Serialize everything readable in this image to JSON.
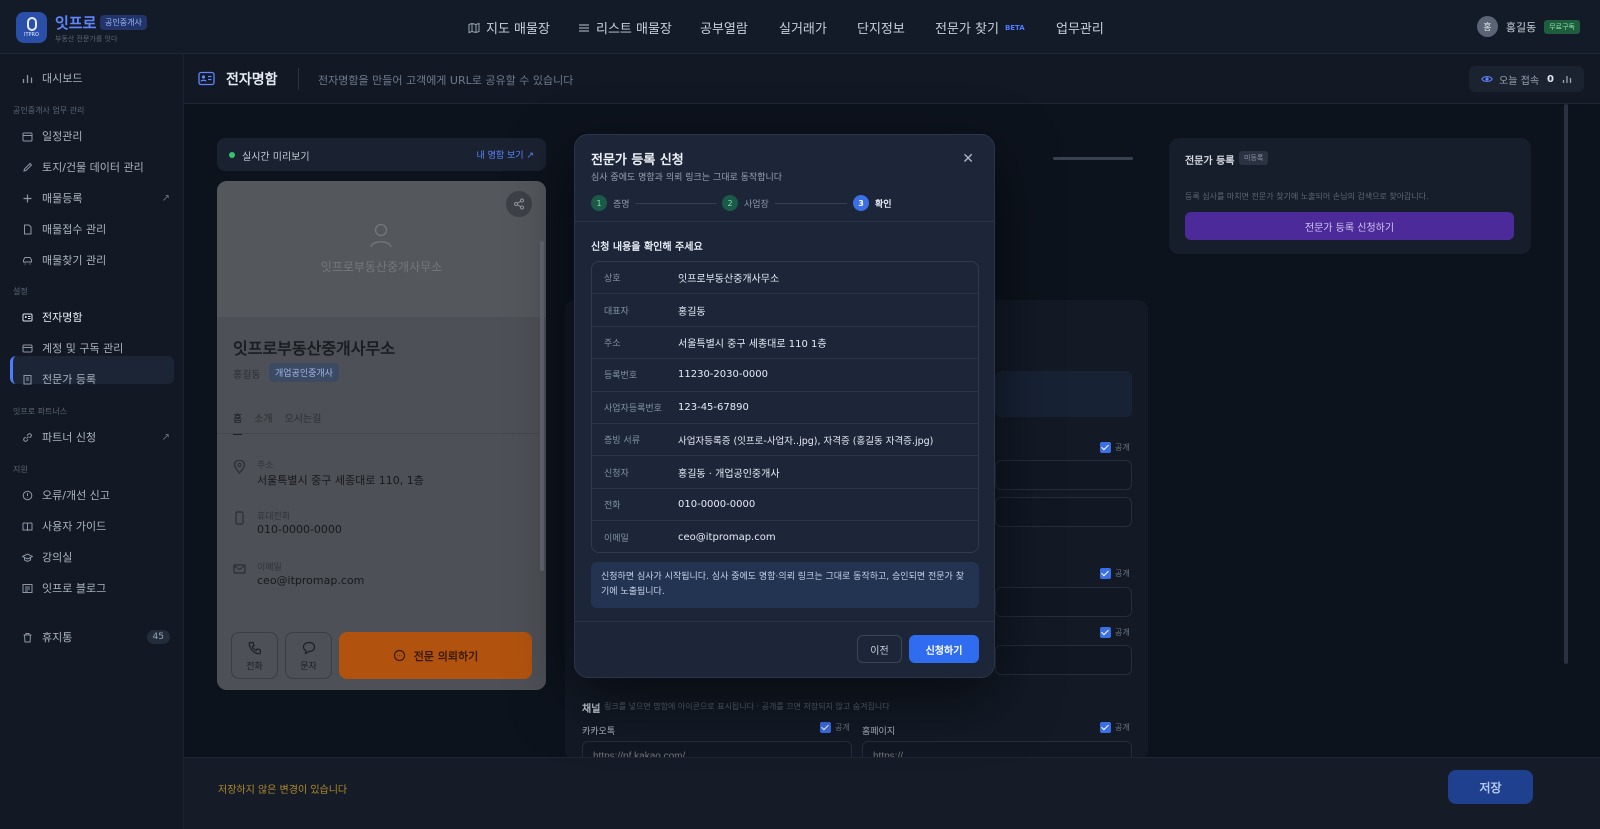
{
  "app": {
    "brand": "잇프로",
    "brand_badge": "공인중개사",
    "tagline": "부동산 전문가를 잇다",
    "logo_text": "ITPRO"
  },
  "nav": {
    "items": [
      "지도 매물장",
      "리스트 매물장",
      "공부열람",
      "실거래가",
      "단지정보",
      "전문가 찾기",
      "업무관리"
    ],
    "beta": "BETA"
  },
  "user": {
    "avatar": "홍",
    "name": "홍길동",
    "plan": "무료구독"
  },
  "sidebar": {
    "dashboard": "대시보드",
    "section1": "공인중개사 업무 관리",
    "items1": [
      "일정관리",
      "토지/건물 데이터 관리",
      "매물등록",
      "매물접수 관리",
      "매물찾기 관리"
    ],
    "section2": "설정",
    "items2": [
      "전자명함",
      "계정 및 구독 관리",
      "전문가 등록"
    ],
    "section3": "잇프로 파트너스",
    "partner": "파트너 신청",
    "section4": "지원",
    "items4": [
      "오류/개선 신고",
      "사용자 가이드",
      "강의실",
      "잇프로 블로그"
    ],
    "trash": "휴지통",
    "trash_count": "45"
  },
  "page": {
    "title": "전자명함",
    "desc": "전자명함을 만들어 고객에게 URL로 공유할 수 있습니다",
    "visit_label": "오늘 접속",
    "visit_count": "0"
  },
  "preview": {
    "label": "실시간 미리보기",
    "link": "내 명함 보기 ↗",
    "cover_name": "잇프로부동산중개사무소",
    "name": "잇프로부동산중개사무소",
    "rep": "홍길동",
    "badge": "개업공인중개사",
    "tabs": [
      "홈",
      "소개",
      "오시는길"
    ],
    "address_label": "주소",
    "address": "서울특별시 중구 세종대로 110, 1층",
    "phone_label": "휴대전화",
    "phone": "010-0000-0000",
    "email_label": "이메일",
    "email": "ceo@itpromap.com",
    "btn_call": "전화",
    "btn_sms": "문자",
    "cta": "전문 의뢰하기"
  },
  "form": {
    "public": "공개",
    "channel_title": "채널",
    "channel_desc": "링크를 넣으면 명함에 아이콘으로 표시됩니다 · 공개를 끄면 저장되지 않고 숨겨집니다",
    "kakao_label": "카카오톡",
    "kakao_ph": "https://pf.kakao.com/",
    "home_label": "홈페이지",
    "home_ph": "https://"
  },
  "expert": {
    "title": "전문가 등록",
    "status": "미등록",
    "desc": "등록 심사를 마치면 전문가 찾기에 노출되어 손님의 검색으로 찾아갑니다.",
    "button": "전문가 등록 신청하기"
  },
  "bottom": {
    "unsaved": "저장하지 않은 변경이 있습니다",
    "save": "저장"
  },
  "modal": {
    "title": "전문가 등록 신청",
    "subtitle": "심사 중에도 명함과 의뢰 링크는 그대로 동작합니다",
    "steps": [
      {
        "n": "1",
        "label": "증명"
      },
      {
        "n": "2",
        "label": "사업장"
      },
      {
        "n": "3",
        "label": "확인"
      }
    ],
    "heading": "신청 내용을 확인해 주세요",
    "rows": [
      {
        "k": "상호",
        "v": "잇프로부동산중개사무소"
      },
      {
        "k": "대표자",
        "v": "홍길동"
      },
      {
        "k": "주소",
        "v": "서울특별시 중구 세종대로 110 1층"
      },
      {
        "k": "등록번호",
        "v": "11230-2030-0000"
      },
      {
        "k": "사업자등록번호",
        "v": "123-45-67890"
      },
      {
        "k": "증빙 서류",
        "v": "사업자등록증 (잇프로-사업자..jpg), 자격증 (홍길동 자격증.jpg)"
      },
      {
        "k": "신청자",
        "v": "홍길동 · 개업공인중개사"
      },
      {
        "k": "전화",
        "v": "010-0000-0000"
      },
      {
        "k": "이메일",
        "v": "ceo@itpromap.com"
      }
    ],
    "note": "신청하면 심사가 시작됩니다. 심사 중에도 명함·의뢰 링크는 그대로 동작하고, 승인되면 전문가 찾기에 노출됩니다.",
    "prev": "이전",
    "submit": "신청하기"
  }
}
